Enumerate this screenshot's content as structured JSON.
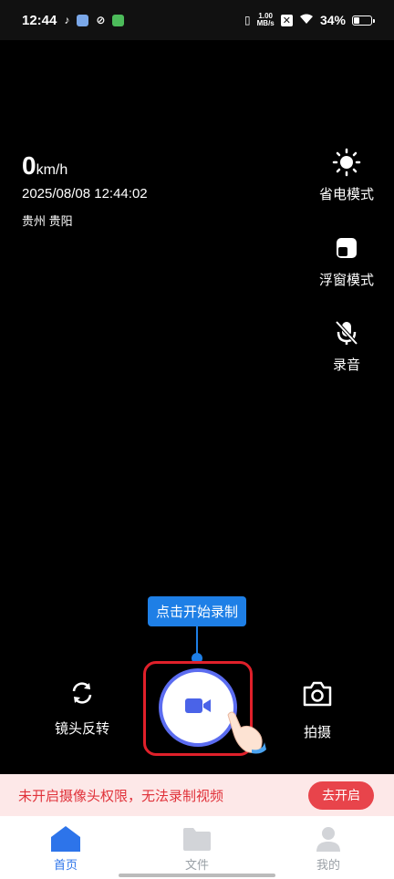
{
  "status_bar": {
    "time": "12:44",
    "net_speed_value": "1.00",
    "net_speed_unit": "MB/s",
    "battery": "34%"
  },
  "dashboard": {
    "speed_value": "0",
    "speed_unit": "km/h",
    "datetime": "2025/08/08 12:44:02",
    "location": "贵州 贵阳"
  },
  "side_controls": [
    {
      "label": "省电模式",
      "icon": "sun-icon"
    },
    {
      "label": "浮窗模式",
      "icon": "floating-window-icon"
    },
    {
      "label": "录音",
      "icon": "mic-off-icon"
    }
  ],
  "tooltip": {
    "text": "点击开始录制"
  },
  "controls": {
    "flip_label": "镜头反转",
    "photo_label": "拍摄",
    "record_icon": "video-camera-icon"
  },
  "banner": {
    "text": "未开启摄像头权限，无法录制视频",
    "button": "去开启"
  },
  "tabs": [
    {
      "label": "首页",
      "icon": "home-icon",
      "active": true
    },
    {
      "label": "文件",
      "icon": "folder-icon",
      "active": false
    },
    {
      "label": "我的",
      "icon": "person-icon",
      "active": false
    }
  ],
  "colors": {
    "accent": "#1e7fe6",
    "record_ring": "#5b6cf0",
    "warning": "#e0323a",
    "highlight_box": "#e0202a"
  }
}
